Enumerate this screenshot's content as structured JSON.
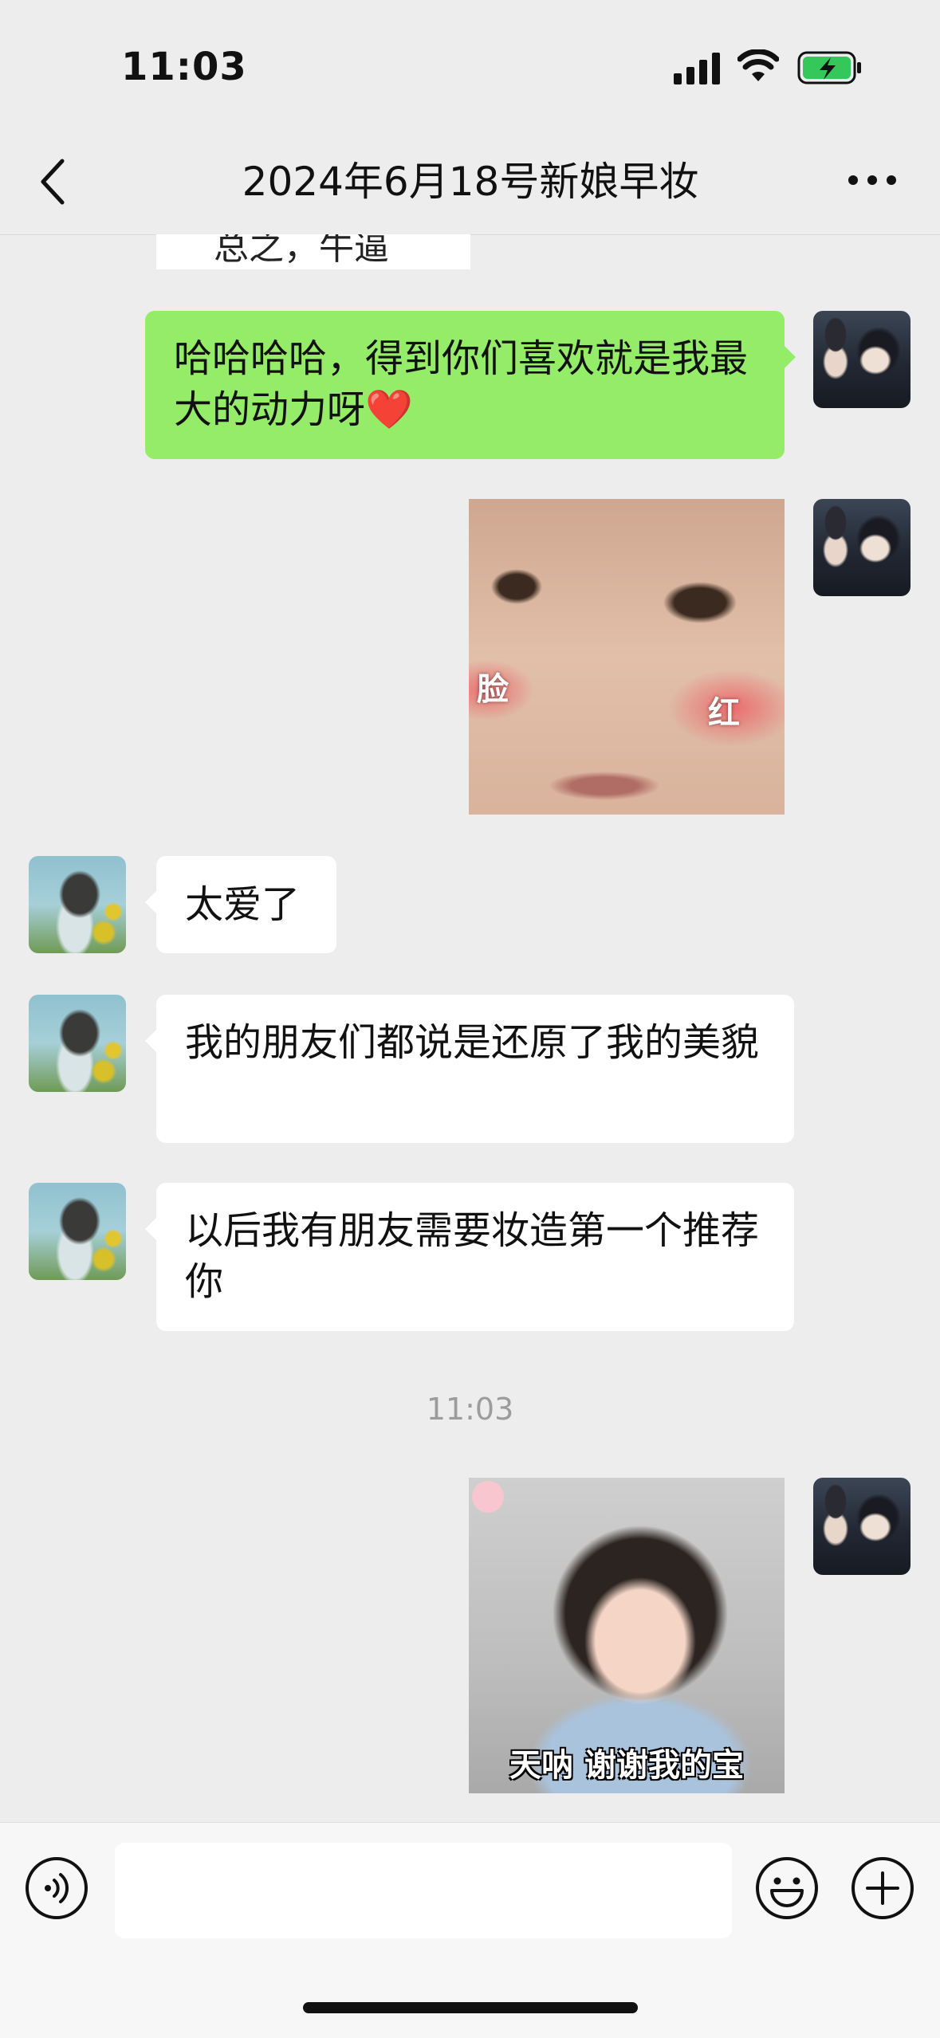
{
  "status_bar": {
    "time": "11:03"
  },
  "nav": {
    "title": "2024年6月18号新娘早妆"
  },
  "chat": {
    "top_cut_text": "总之，牛逼",
    "messages": [
      {
        "from": "me",
        "type": "text",
        "text": "哈哈哈哈，得到你们喜欢就是我最大的动力呀",
        "emoji": "❤️"
      },
      {
        "from": "me",
        "type": "sticker",
        "caption_left": "脸",
        "caption_right": "红"
      },
      {
        "from": "other",
        "type": "text",
        "text": "太爱了"
      },
      {
        "from": "other",
        "type": "text",
        "text": "我的朋友们都说是还原了我的美貌"
      },
      {
        "from": "other",
        "type": "text",
        "text": "以后我有朋友需要妆造第一个推荐你"
      },
      {
        "type": "time",
        "text": "11:03"
      },
      {
        "from": "me",
        "type": "sticker",
        "caption": "天呐 谢谢我的宝"
      }
    ]
  },
  "input": {
    "value": ""
  },
  "colors": {
    "bubble_me": "#95ec69",
    "bubble_other": "#ffffff",
    "background": "#ededed"
  }
}
